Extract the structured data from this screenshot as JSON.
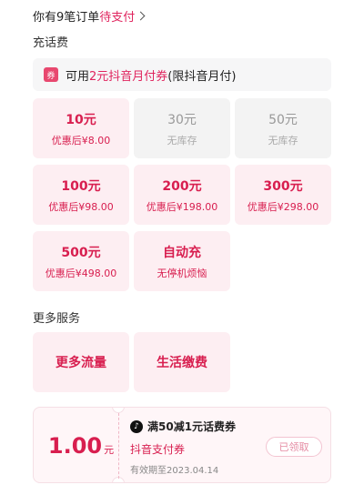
{
  "pending": {
    "prefix": "你有9笔订单",
    "link": "待支付"
  },
  "recharge": {
    "title": "充话费",
    "coupon_tip": {
      "tag": "券",
      "prefix": "可用",
      "highlight": "2元抖音月付券",
      "suffix": "(限抖音月付)"
    },
    "tiles": [
      {
        "label": "10元",
        "sub": "优惠后¥8.00",
        "available": true
      },
      {
        "label": "30元",
        "sub": "无库存",
        "available": false
      },
      {
        "label": "50元",
        "sub": "无库存",
        "available": false
      },
      {
        "label": "100元",
        "sub": "优惠后¥98.00",
        "available": true
      },
      {
        "label": "200元",
        "sub": "优惠后¥198.00",
        "available": true
      },
      {
        "label": "300元",
        "sub": "优惠后¥298.00",
        "available": true
      },
      {
        "label": "500元",
        "sub": "优惠后¥498.00",
        "available": true
      },
      {
        "label": "自动充",
        "sub": "无停机烦恼",
        "available": true
      }
    ]
  },
  "more": {
    "title": "更多服务",
    "items": [
      "更多流量",
      "生活缴费"
    ]
  },
  "voucher": {
    "amount": "1.00",
    "unit": "元",
    "title": "满50减1元话费券",
    "pay_method": "抖音支付券",
    "valid": "有效期至2023.04.14",
    "status": "已领取"
  }
}
